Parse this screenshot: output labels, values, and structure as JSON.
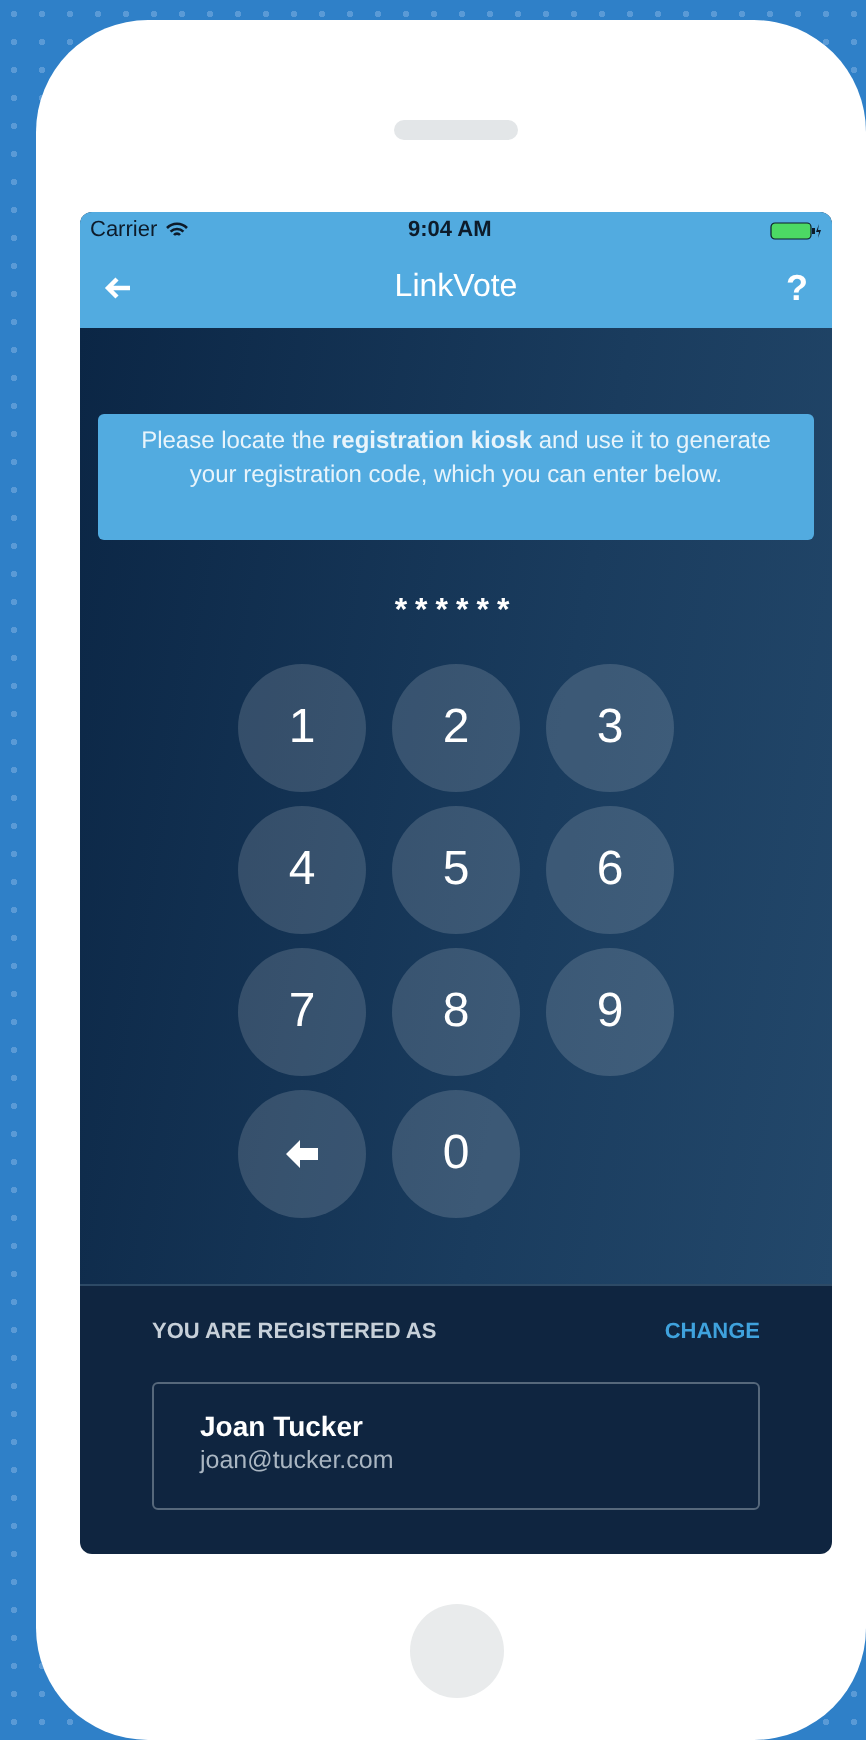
{
  "status_bar": {
    "carrier": "Carrier",
    "time": "9:04 AM"
  },
  "nav": {
    "title": "LinkVote",
    "help": "?"
  },
  "info": "Please locate the **registration kiosk** and use it to generate your registration code, which you can enter below.",
  "code": "******",
  "keypad": [
    {
      "kind": "digit",
      "label": "1"
    },
    {
      "kind": "digit",
      "label": "2"
    },
    {
      "kind": "digit",
      "label": "3"
    },
    {
      "kind": "digit",
      "label": "4"
    },
    {
      "kind": "digit",
      "label": "5"
    },
    {
      "kind": "digit",
      "label": "6"
    },
    {
      "kind": "digit",
      "label": "7"
    },
    {
      "kind": "digit",
      "label": "8"
    },
    {
      "kind": "digit",
      "label": "9"
    },
    {
      "kind": "backspace"
    },
    {
      "kind": "digit",
      "label": "0"
    }
  ],
  "registration": {
    "heading": "YOU ARE REGISTERED AS",
    "action": "CHANGE",
    "name": "Joan Tucker",
    "email": "joan@tucker.com"
  }
}
